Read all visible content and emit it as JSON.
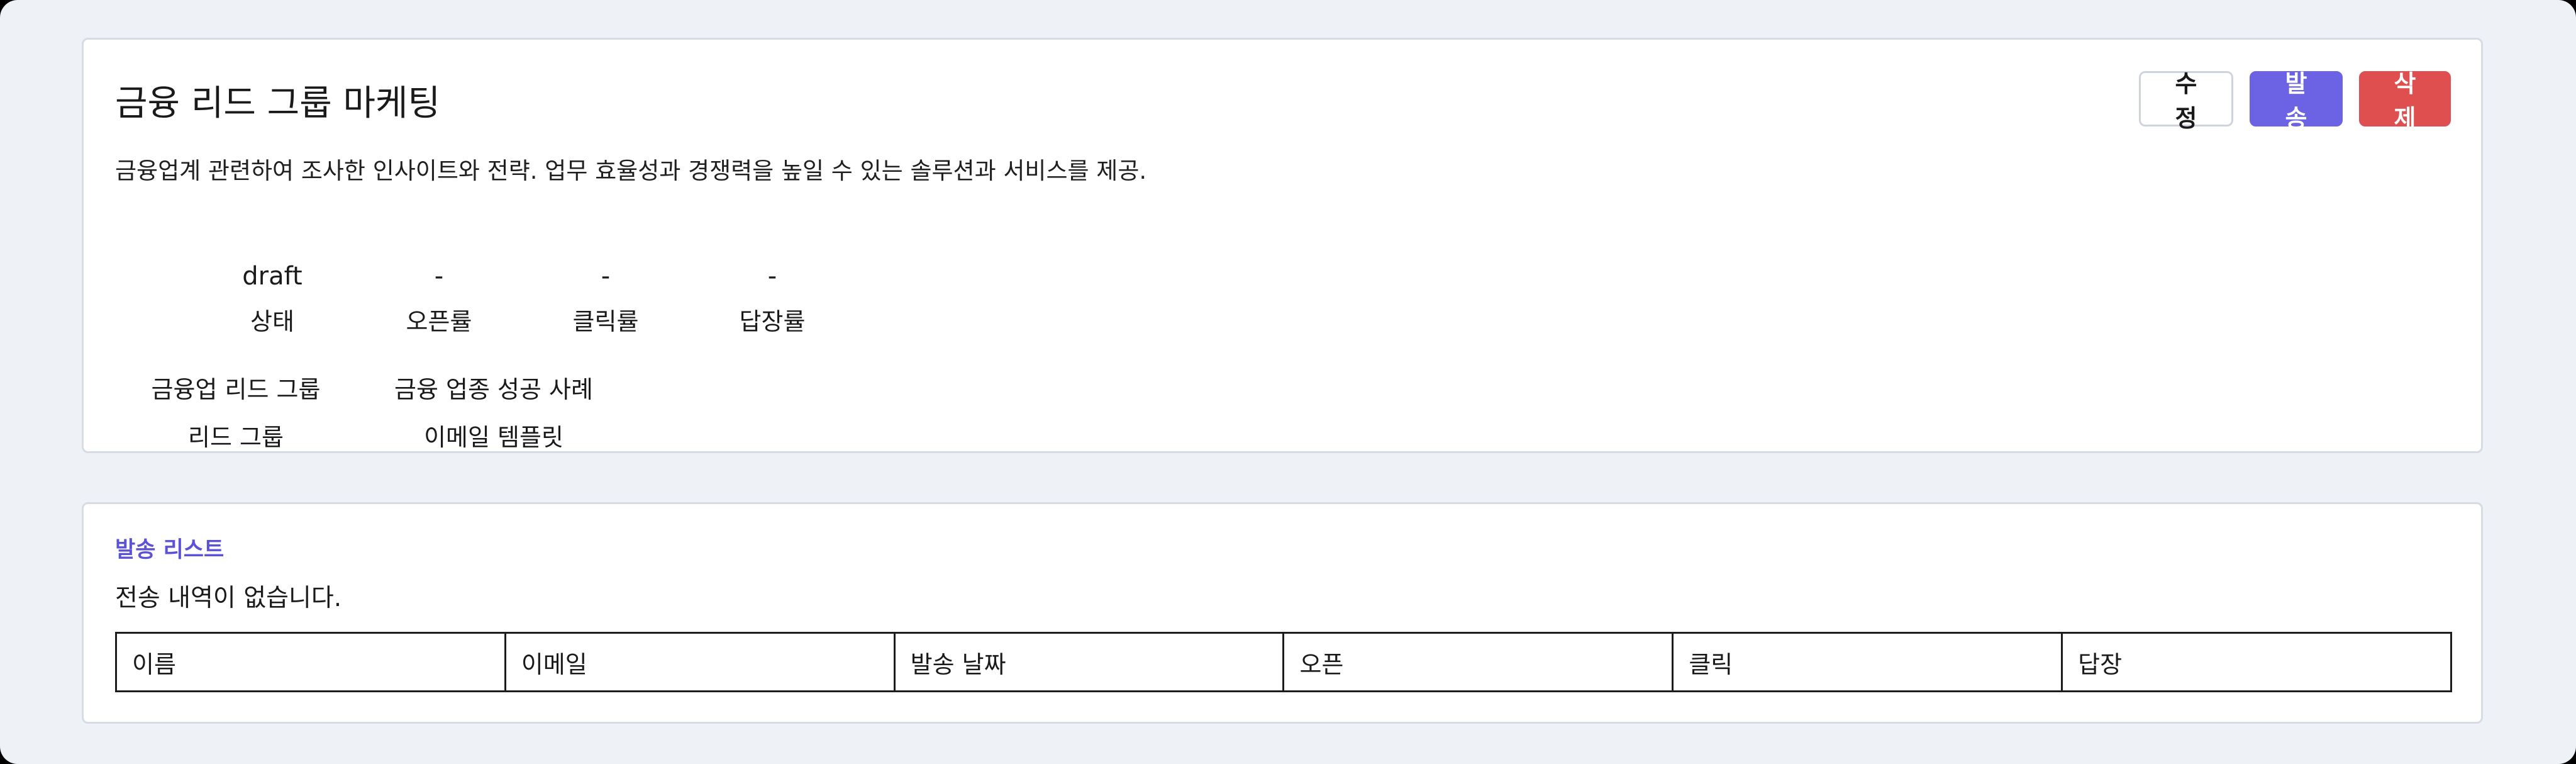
{
  "campaign": {
    "title": "금융 리드 그룹 마케팅",
    "description": "금융업계 관련하여 조사한 인사이트와 전략. 업무 효율성과 경쟁력을 높일 수 있는 솔루션과 서비스를 제공.",
    "actions": {
      "edit_label": "수정",
      "send_label": "발송",
      "delete_label": "삭제"
    },
    "stats": [
      {
        "value": "draft",
        "label": "상태"
      },
      {
        "value": "-",
        "label": "오픈률"
      },
      {
        "value": "-",
        "label": "클릭률"
      },
      {
        "value": "-",
        "label": "답장률"
      }
    ],
    "info": [
      {
        "value": "금융업 리드 그룹",
        "label": "리드 그룹"
      },
      {
        "value": "금융 업종 성공 사례",
        "label": "이메일 템플릿"
      }
    ]
  },
  "send_list": {
    "title": "발송 리스트",
    "empty_message": "전송 내역이 없습니다.",
    "columns": [
      "이름",
      "이메일",
      "발송 날짜",
      "오픈",
      "클릭",
      "답장"
    ]
  },
  "colors": {
    "page_background": "#eef1f6",
    "primary": "#6b62e4",
    "danger": "#e04f4f",
    "section_title": "#5b52d6"
  }
}
